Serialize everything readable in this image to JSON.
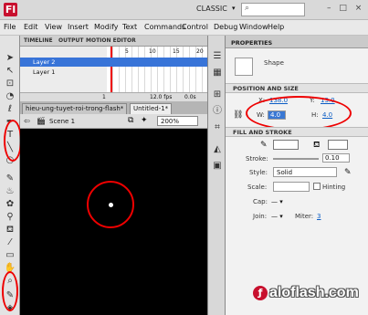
{
  "app": {
    "logo_letter": "Fl",
    "workspace": "CLASSIC",
    "search_placeholder": "",
    "window_controls": "– □ ×"
  },
  "menu": [
    "File",
    "Edit",
    "View",
    "Insert",
    "Modify",
    "Text",
    "Commands",
    "Control",
    "Debug",
    "Window",
    "Help"
  ],
  "timeline": {
    "tabs": [
      "TIMELINE",
      "OUTPUT",
      "MOTION EDITOR"
    ],
    "frame_numbers": [
      "5",
      "10",
      "15",
      "20"
    ],
    "layers": [
      "Layer 2",
      "Layer 1"
    ],
    "fps": "12.0 fps",
    "time": "0.0s",
    "frame": "1"
  },
  "documents": {
    "tabs": [
      "hieu-ung-tuyet-roi-trong-flash*",
      "Untitled-1*"
    ]
  },
  "scene": {
    "name": "Scene 1",
    "zoom": "200%"
  },
  "properties": {
    "title": "PROPERTIES",
    "instance": "Shape",
    "position_section": "POSITION AND SIZE",
    "x_label": "X:",
    "x_value": "138.0",
    "y_label": "Y:",
    "y_value": "13.0",
    "w_label": "W:",
    "w_value": "4.0",
    "h_label": "H:",
    "h_value": "4.0",
    "fill_section": "FILL AND STROKE",
    "stroke_label": "Stroke:",
    "stroke_value": "0.10",
    "style_label": "Style:",
    "style_value": "Solid",
    "scale_label": "Scale:",
    "hinting_label": "Hinting",
    "cap_label": "Cap:",
    "join_label": "Join:",
    "miter_label": "Miter:",
    "miter_value": "3"
  },
  "watermark": "aloflash.com",
  "colors": {
    "highlight_ring": "#e00000",
    "stage": "#000000"
  }
}
